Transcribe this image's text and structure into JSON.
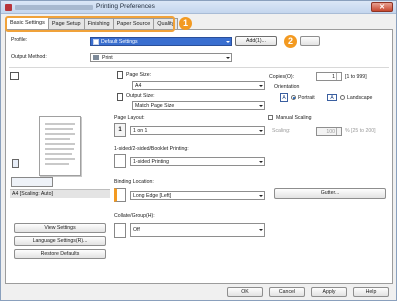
{
  "window": {
    "title": "Printing Preferences",
    "close_glyph": "✕"
  },
  "tabs": [
    "Basic Settings",
    "Page Setup",
    "Finishing",
    "Paper Source",
    "Quality"
  ],
  "callouts": {
    "one": "1",
    "two": "2"
  },
  "profile": {
    "label": "Profile:",
    "value": "Default Settings",
    "add_button": "Add(1)..."
  },
  "output_method": {
    "label": "Output Method:",
    "value": "Print"
  },
  "preview": {
    "status": "A4 [Scaling: Auto]"
  },
  "page_size": {
    "label": "Page Size:",
    "value": "A4"
  },
  "output_size": {
    "label": "Output Size:",
    "value": "Match Page Size"
  },
  "page_layout": {
    "label": "Page Layout:",
    "value": "1 on 1",
    "icon_text": "1"
  },
  "sided": {
    "label": "1-sided/2-sided/Booklet Printing:",
    "value": "1-sided Printing"
  },
  "binding": {
    "label": "Binding Location:",
    "value": "Long Edge [Left]",
    "gutter_button": "Gutter..."
  },
  "collate": {
    "label": "Collate/Group(H):",
    "value": "Off"
  },
  "copies": {
    "label": "Copies(O):",
    "value": "1",
    "range": "[1 to 999]"
  },
  "orientation": {
    "label": "Orientation",
    "portrait": "Portrait",
    "landscape": "Landscape",
    "selected": "Portrait"
  },
  "manual_scaling": {
    "label": "Manual Scaling",
    "checked": false
  },
  "scaling": {
    "label": "Scaling:",
    "value": "100",
    "range": "% [25 to 200]"
  },
  "left_buttons": {
    "view_settings": "View Settings",
    "language_settings": "Language Settings(R)...",
    "restore_defaults": "Restore Defaults"
  },
  "footer": {
    "ok": "OK",
    "cancel": "Cancel",
    "apply": "Apply",
    "help": "Help"
  },
  "colors": {
    "accent": "#f39a21",
    "title_bar": "#c4d6ee",
    "selection": "#3a6fd0"
  }
}
